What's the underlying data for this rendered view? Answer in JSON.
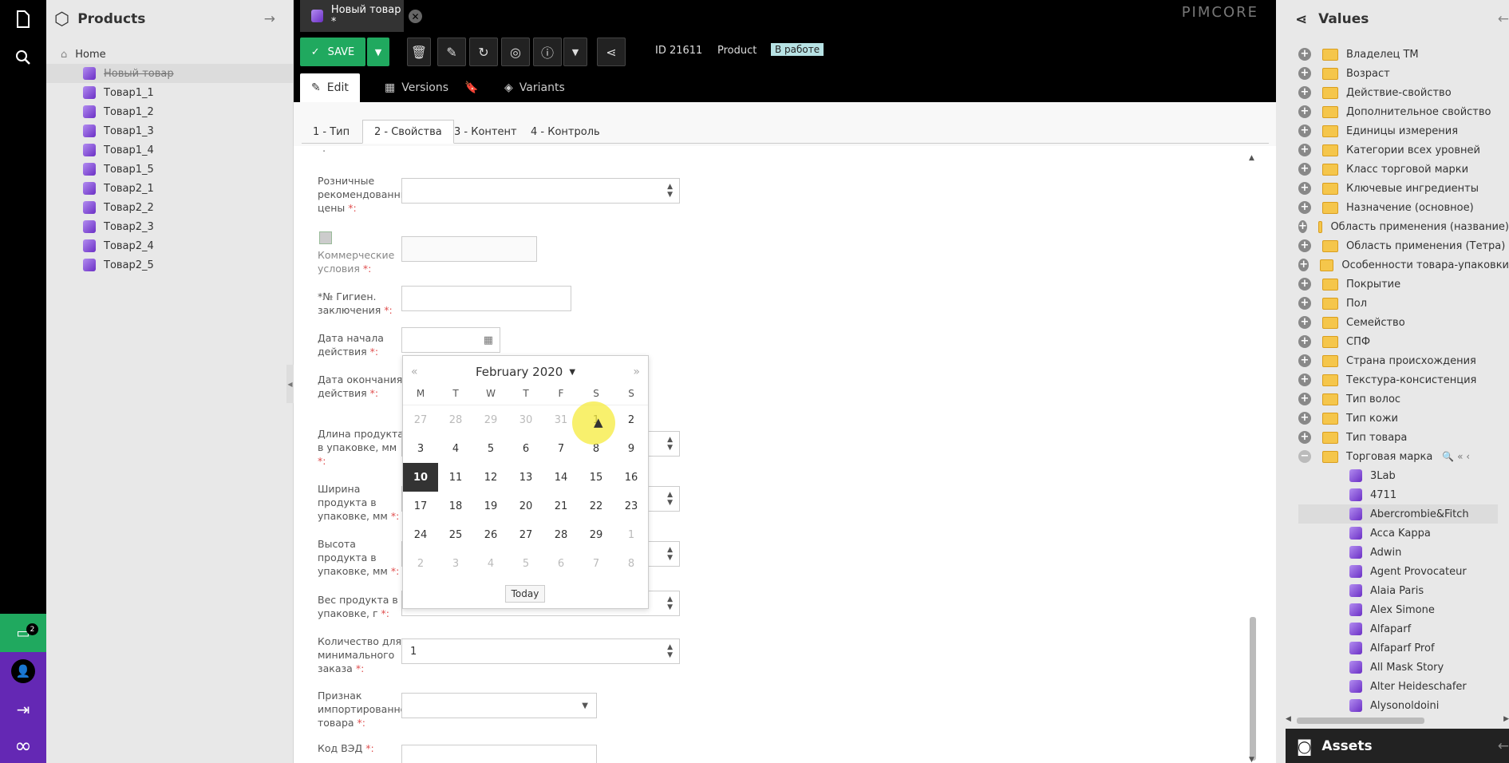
{
  "app": {
    "brand": "PIMCORE"
  },
  "rail": {
    "chat_count": "2"
  },
  "left_panel": {
    "title": "Products",
    "root": "Home",
    "items": [
      "Новый товар",
      "Товар1_1",
      "Товар1_2",
      "Товар1_3",
      "Товар1_4",
      "Товар1_5",
      "Товар2_1",
      "Товар2_2",
      "Товар2_3",
      "Товар2_4",
      "Товар2_5"
    ]
  },
  "document_tab": {
    "label": "Новый товар *"
  },
  "toolbar": {
    "save_label": "SAVE",
    "id_text": "ID 21611",
    "class_text": "Product",
    "status_badge": "В работе"
  },
  "editor_tabs": [
    "Edit",
    "Versions",
    "",
    "Variants"
  ],
  "form_tabs": [
    "1 - Тип",
    "2 - Свойства",
    "3 - Контент",
    "4 - Контроль"
  ],
  "form": {
    "dot": "·",
    "retail_price": {
      "label": "Розничные рекомендованные цены",
      "value": ""
    },
    "commercial": {
      "label": "Коммерческие условия",
      "value": ""
    },
    "hygiene": {
      "label": "*№ Гигиен. заключения",
      "value": ""
    },
    "start_date": {
      "label": "Дата начала действия",
      "value": ""
    },
    "end_date": {
      "label": "Дата окончания действия"
    },
    "length": {
      "label": "Длина продукта в упаковке, мм"
    },
    "width": {
      "label": "Ширина продукта в упаковке, мм"
    },
    "height": {
      "label": "Высота продукта в упаковке, мм"
    },
    "weight": {
      "label": "Вес продукта в упаковке, г"
    },
    "min_order": {
      "label": "Количество для минимального заказа",
      "value": "1"
    },
    "imported": {
      "label": "Признак импортированного товара",
      "value": ""
    },
    "ved_code": {
      "label": "Код ВЭД"
    },
    "required_mark": "*:"
  },
  "datepicker": {
    "month_label": "February 2020",
    "weekdays": [
      "M",
      "T",
      "W",
      "T",
      "F",
      "S",
      "S"
    ],
    "weeks": [
      [
        "27",
        "28",
        "29",
        "30",
        "31",
        "1",
        "2"
      ],
      [
        "3",
        "4",
        "5",
        "6",
        "7",
        "8",
        "9"
      ],
      [
        "10",
        "11",
        "12",
        "13",
        "14",
        "15",
        "16"
      ],
      [
        "17",
        "18",
        "19",
        "20",
        "21",
        "22",
        "23"
      ],
      [
        "24",
        "25",
        "26",
        "27",
        "28",
        "29",
        "1"
      ],
      [
        "2",
        "3",
        "4",
        "5",
        "6",
        "7",
        "8"
      ]
    ],
    "selected": "10",
    "today_label": "Today"
  },
  "right_panel": {
    "title": "Values",
    "folders": [
      "Владелец ТМ",
      "Возраст",
      "Действие-свойство",
      "Дополнительное свойство",
      "Единицы измерения",
      "Категории всех уровней",
      "Класс торговой марки",
      "Ключевые ингредиенты",
      "Назначение (основное)",
      "Область применения (название)",
      "Область применения (Тетра)",
      "Особенности товара-упаковки",
      "Покрытие",
      "Пол",
      "Семейство",
      "СПФ",
      "Страна происхождения",
      "Текстура-консистенция",
      "Тип волос",
      "Тип кожи",
      "Тип товара",
      "Торговая марка"
    ],
    "brands": [
      "3Lab",
      "4711",
      "Abercrombie&Fitch",
      "Acca Kappa",
      "Adwin",
      "Agent Provocateur",
      "Alaia Paris",
      "Alex Simone",
      "Alfaparf",
      "Alfaparf Prof",
      "All Mask Story",
      "Alter Heideschafer",
      "Alysonoldoini"
    ],
    "assets_title": "Assets"
  }
}
